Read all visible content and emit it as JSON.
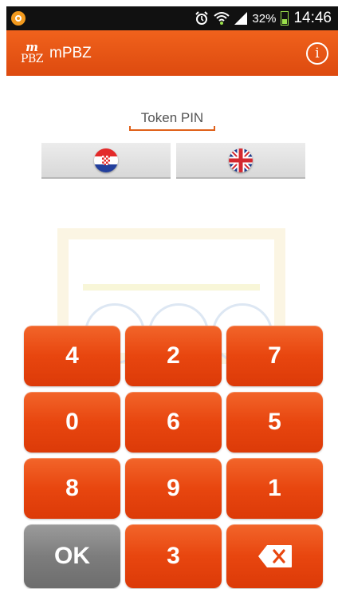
{
  "status_bar": {
    "battery_percent": "32%",
    "time": "14:46"
  },
  "app_bar": {
    "logo_m": "m",
    "logo_text": "PBZ",
    "title": "mPBZ",
    "info_icon": "i"
  },
  "pin": {
    "label": "Token PIN"
  },
  "languages": [
    {
      "name": "croatian-flag-icon"
    },
    {
      "name": "uk-flag-icon"
    }
  ],
  "keypad": {
    "keys": [
      "4",
      "2",
      "7",
      "0",
      "6",
      "5",
      "8",
      "9",
      "1"
    ],
    "ok_label": "OK",
    "third_label": "3",
    "backspace_icon": "backspace-icon"
  },
  "colors": {
    "accent": "#e8460f",
    "ok_gray": "#7d7d7d"
  }
}
